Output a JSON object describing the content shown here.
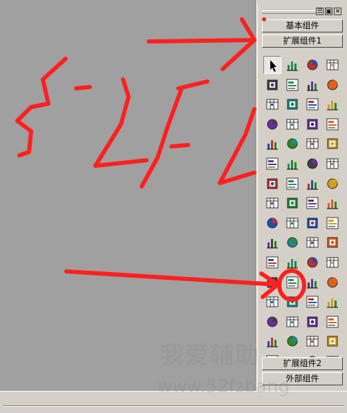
{
  "palette": {
    "title_buttons": [
      {
        "name": "menu-icon",
        "glyph": "☰"
      },
      {
        "name": "maximize-icon",
        "glyph": "▣"
      },
      {
        "name": "close-icon",
        "glyph": "✕"
      }
    ],
    "categories_top": [
      "基本组件",
      "扩展组件1"
    ],
    "categories_bottom": [
      "扩展组件2",
      "外部组件"
    ],
    "components": [
      "pointer-icon",
      "picture-box-icon",
      "turtle-icon",
      "progress-icon",
      "notepad-icon",
      "socket-icon",
      "drawing-icon",
      "table-icon",
      "camera-icon",
      "bar-chart-icon",
      "pie-chart-icon",
      "line-chart-icon",
      "database-icon",
      "grid-icon",
      "tree-icon",
      "text-label-icon",
      "calendar-icon",
      "org-chart-icon",
      "folder-icon",
      "list-icon",
      "list-box-icon",
      "transparent-label-icon",
      "speech-bubble-icon",
      "html-browser-icon",
      "phone-icon",
      "window-icon",
      "edit-icon",
      "spinner-icon",
      "ruler-icon",
      "splitter-icon",
      "check-list-icon",
      "dots-icon",
      "image-icon",
      "drag-icon",
      "ie-icon",
      "sound-icon",
      "speaker-icon",
      "record-icon",
      "midi-icon",
      "audio-icon",
      "cd-icon",
      "mp3-icon",
      "music-icon",
      "converter-icon",
      "form-icon",
      "globe-icon",
      "document-icon",
      "stack-icon",
      "word-icon",
      "text-icon",
      "page-icon",
      "vcl-icon",
      "vcl2-icon",
      "combo-icon",
      "check-grid-icon",
      "color-grid-icon",
      "search-icon",
      "label-ab-icon",
      "numpad-icon",
      "ok-icon",
      "list-view-icon",
      "report-icon",
      "alt-icon",
      "open-folder-icon"
    ],
    "selected_component": 0,
    "watermark": "我爱辅助",
    "watermark_url": "www.52fzbang"
  }
}
